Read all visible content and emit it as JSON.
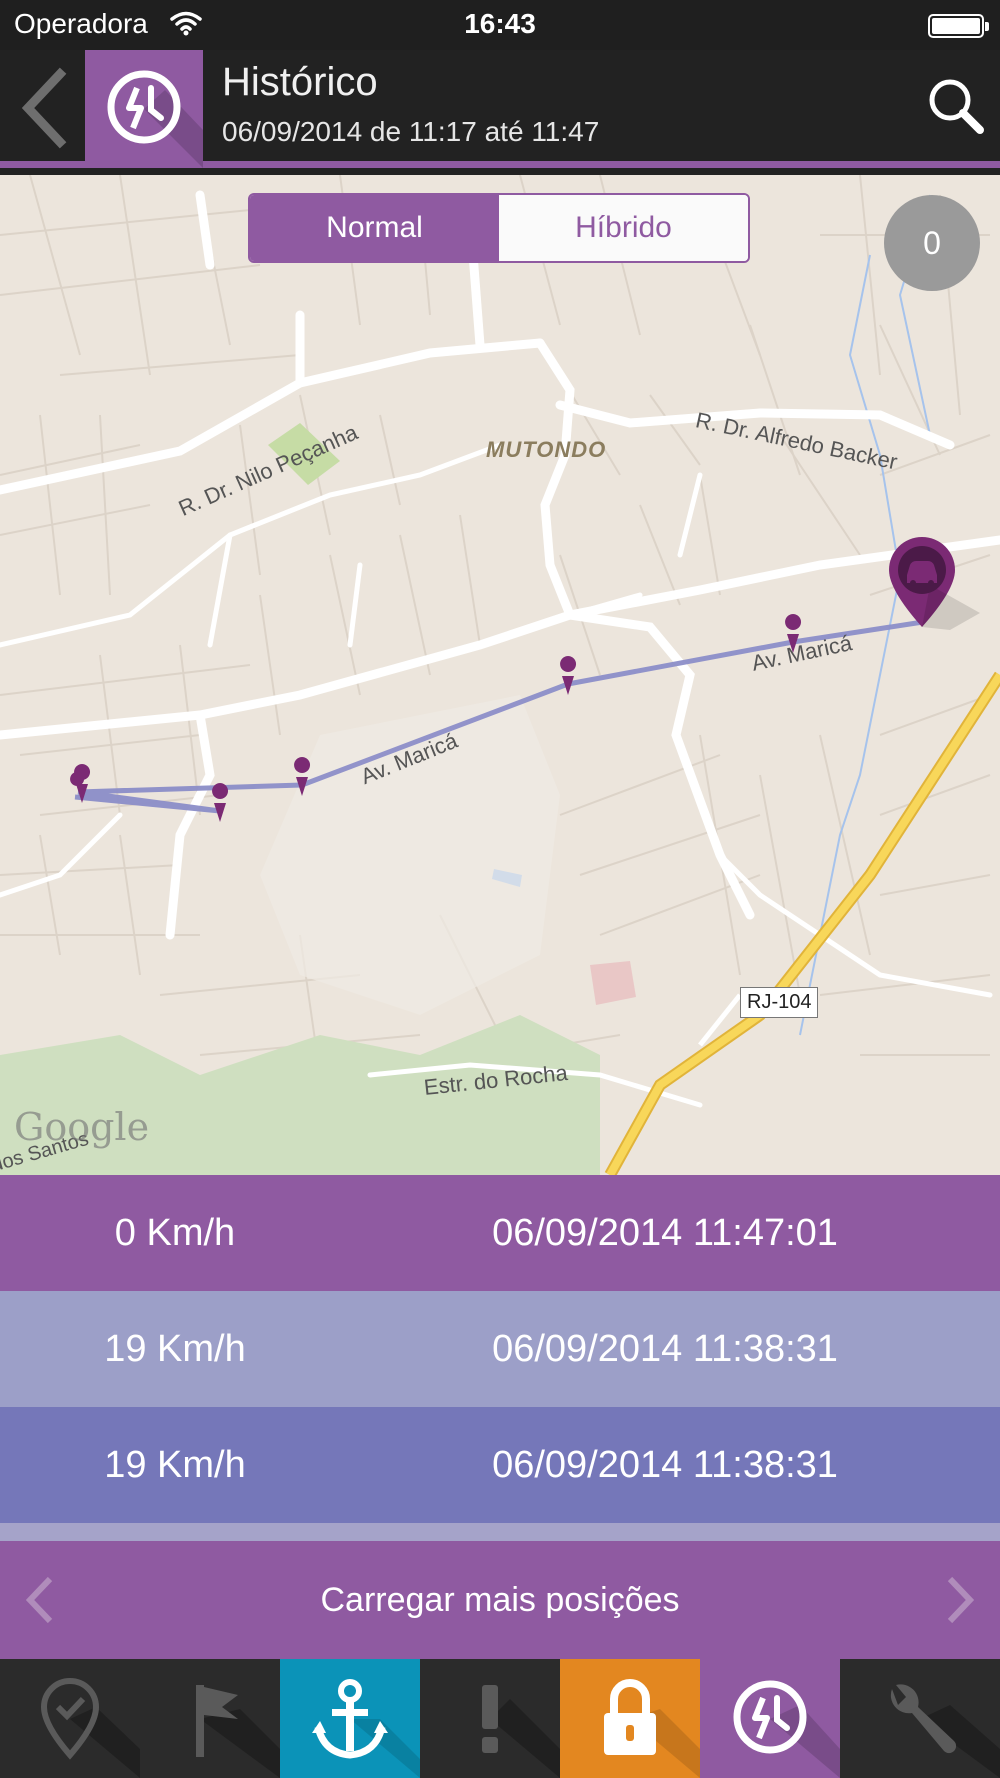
{
  "status_bar": {
    "carrier": "Operadora",
    "time": "16:43"
  },
  "header": {
    "title": "Histórico",
    "subtitle": "06/09/2014 de 11:17 até 11:47"
  },
  "map": {
    "view_toggle": {
      "options": [
        "Normal",
        "Híbrido"
      ],
      "selected": "Normal"
    },
    "counter": "0",
    "street_labels": {
      "nilo_pecanha": "R. Dr. Nilo Peçanha",
      "alfredo_backer": "R. Dr. Alfredo Backer",
      "marica_1": "Av. Maricá",
      "marica_2": "Av. Maricá",
      "estr_rocha": "Estr. do Rocha",
      "dos_santos": "dos Santos",
      "rj104": "RJ-104"
    },
    "area_label": "MUTONDO",
    "attribution": "Google",
    "colors": {
      "route": "#8c8ec8",
      "marker": "#7b2a74",
      "highway": "#f3cf45"
    }
  },
  "positions": [
    {
      "speed": "0 Km/h",
      "datetime": "06/09/2014 11:47:01",
      "color": "#8f5aa1"
    },
    {
      "speed": "19 Km/h",
      "datetime": "06/09/2014 11:38:31",
      "color": "#9c9fc8"
    },
    {
      "speed": "19 Km/h",
      "datetime": "06/09/2014 11:38:31",
      "color": "#7577b9"
    }
  ],
  "load_more": {
    "label": "Carregar mais posições"
  },
  "tab_bar": {
    "tabs": [
      {
        "icon": "location-check-icon",
        "bg": "#2b2b2b"
      },
      {
        "icon": "flag-icon",
        "bg": "#2b2b2b"
      },
      {
        "icon": "anchor-icon",
        "bg": "#0b93b8"
      },
      {
        "icon": "alert-icon",
        "bg": "#2b2b2b"
      },
      {
        "icon": "lock-icon",
        "bg": "#e38720"
      },
      {
        "icon": "history-icon",
        "bg": "#8f5aa1",
        "selected": true
      },
      {
        "icon": "wrench-icon",
        "bg": "#2b2b2b"
      }
    ]
  },
  "colors": {
    "accent": "#8f5aa1",
    "header_bg": "#222222"
  }
}
